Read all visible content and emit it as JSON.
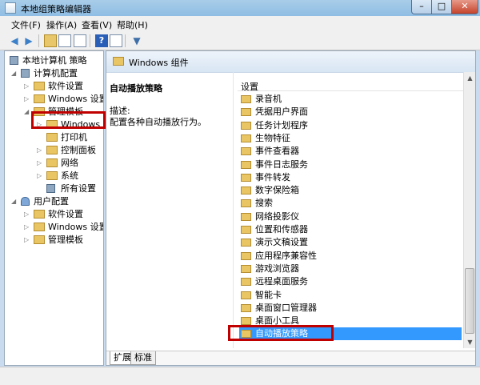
{
  "window": {
    "title": "本地组策略编辑器",
    "close_glyph": "✕",
    "min_glyph": "–",
    "max_glyph": "□"
  },
  "menu": [
    {
      "label": "文件(F)"
    },
    {
      "label": "操作(A)"
    },
    {
      "label": "查看(V)"
    },
    {
      "label": "帮助(H)"
    }
  ],
  "toolbar_icons": [
    "back-arrow-icon",
    "forward-arrow-icon",
    "up-folder-icon",
    "show-tree-icon",
    "refresh-icon",
    "help-icon",
    "properties-icon",
    "filter-icon"
  ],
  "tree": {
    "root": "本地计算机 策略",
    "computer_config": "计算机配置",
    "computer_children": [
      "软件设置",
      "Windows 设置",
      "管理模板"
    ],
    "admin_children": [
      "Windows 组",
      "打印机",
      "控制面板",
      "网络",
      "系统",
      "所有设置"
    ],
    "user_config": "用户配置",
    "user_children": [
      "软件设置",
      "Windows 设置",
      "管理模板"
    ]
  },
  "right": {
    "header": "Windows 组件",
    "desc_title": "自动播放策略",
    "desc_label": "描述:",
    "desc_text": "配置各种自动播放行为。",
    "list_header": "设置",
    "items": [
      "录音机",
      "凭据用户界面",
      "任务计划程序",
      "生物特征",
      "事件查看器",
      "事件日志服务",
      "事件转发",
      "数字保险箱",
      "搜索",
      "网络投影仪",
      "位置和传感器",
      "演示文稿设置",
      "应用程序兼容性",
      "游戏浏览器",
      "远程桌面服务",
      "智能卡",
      "桌面窗口管理器",
      "桌面小工具",
      "自动播放策略"
    ],
    "selected_item": "自动播放策略",
    "tabs": [
      "扩展",
      "标准"
    ]
  },
  "colors": {
    "highlight_box": "#c00000",
    "selection": "#3399ff"
  }
}
